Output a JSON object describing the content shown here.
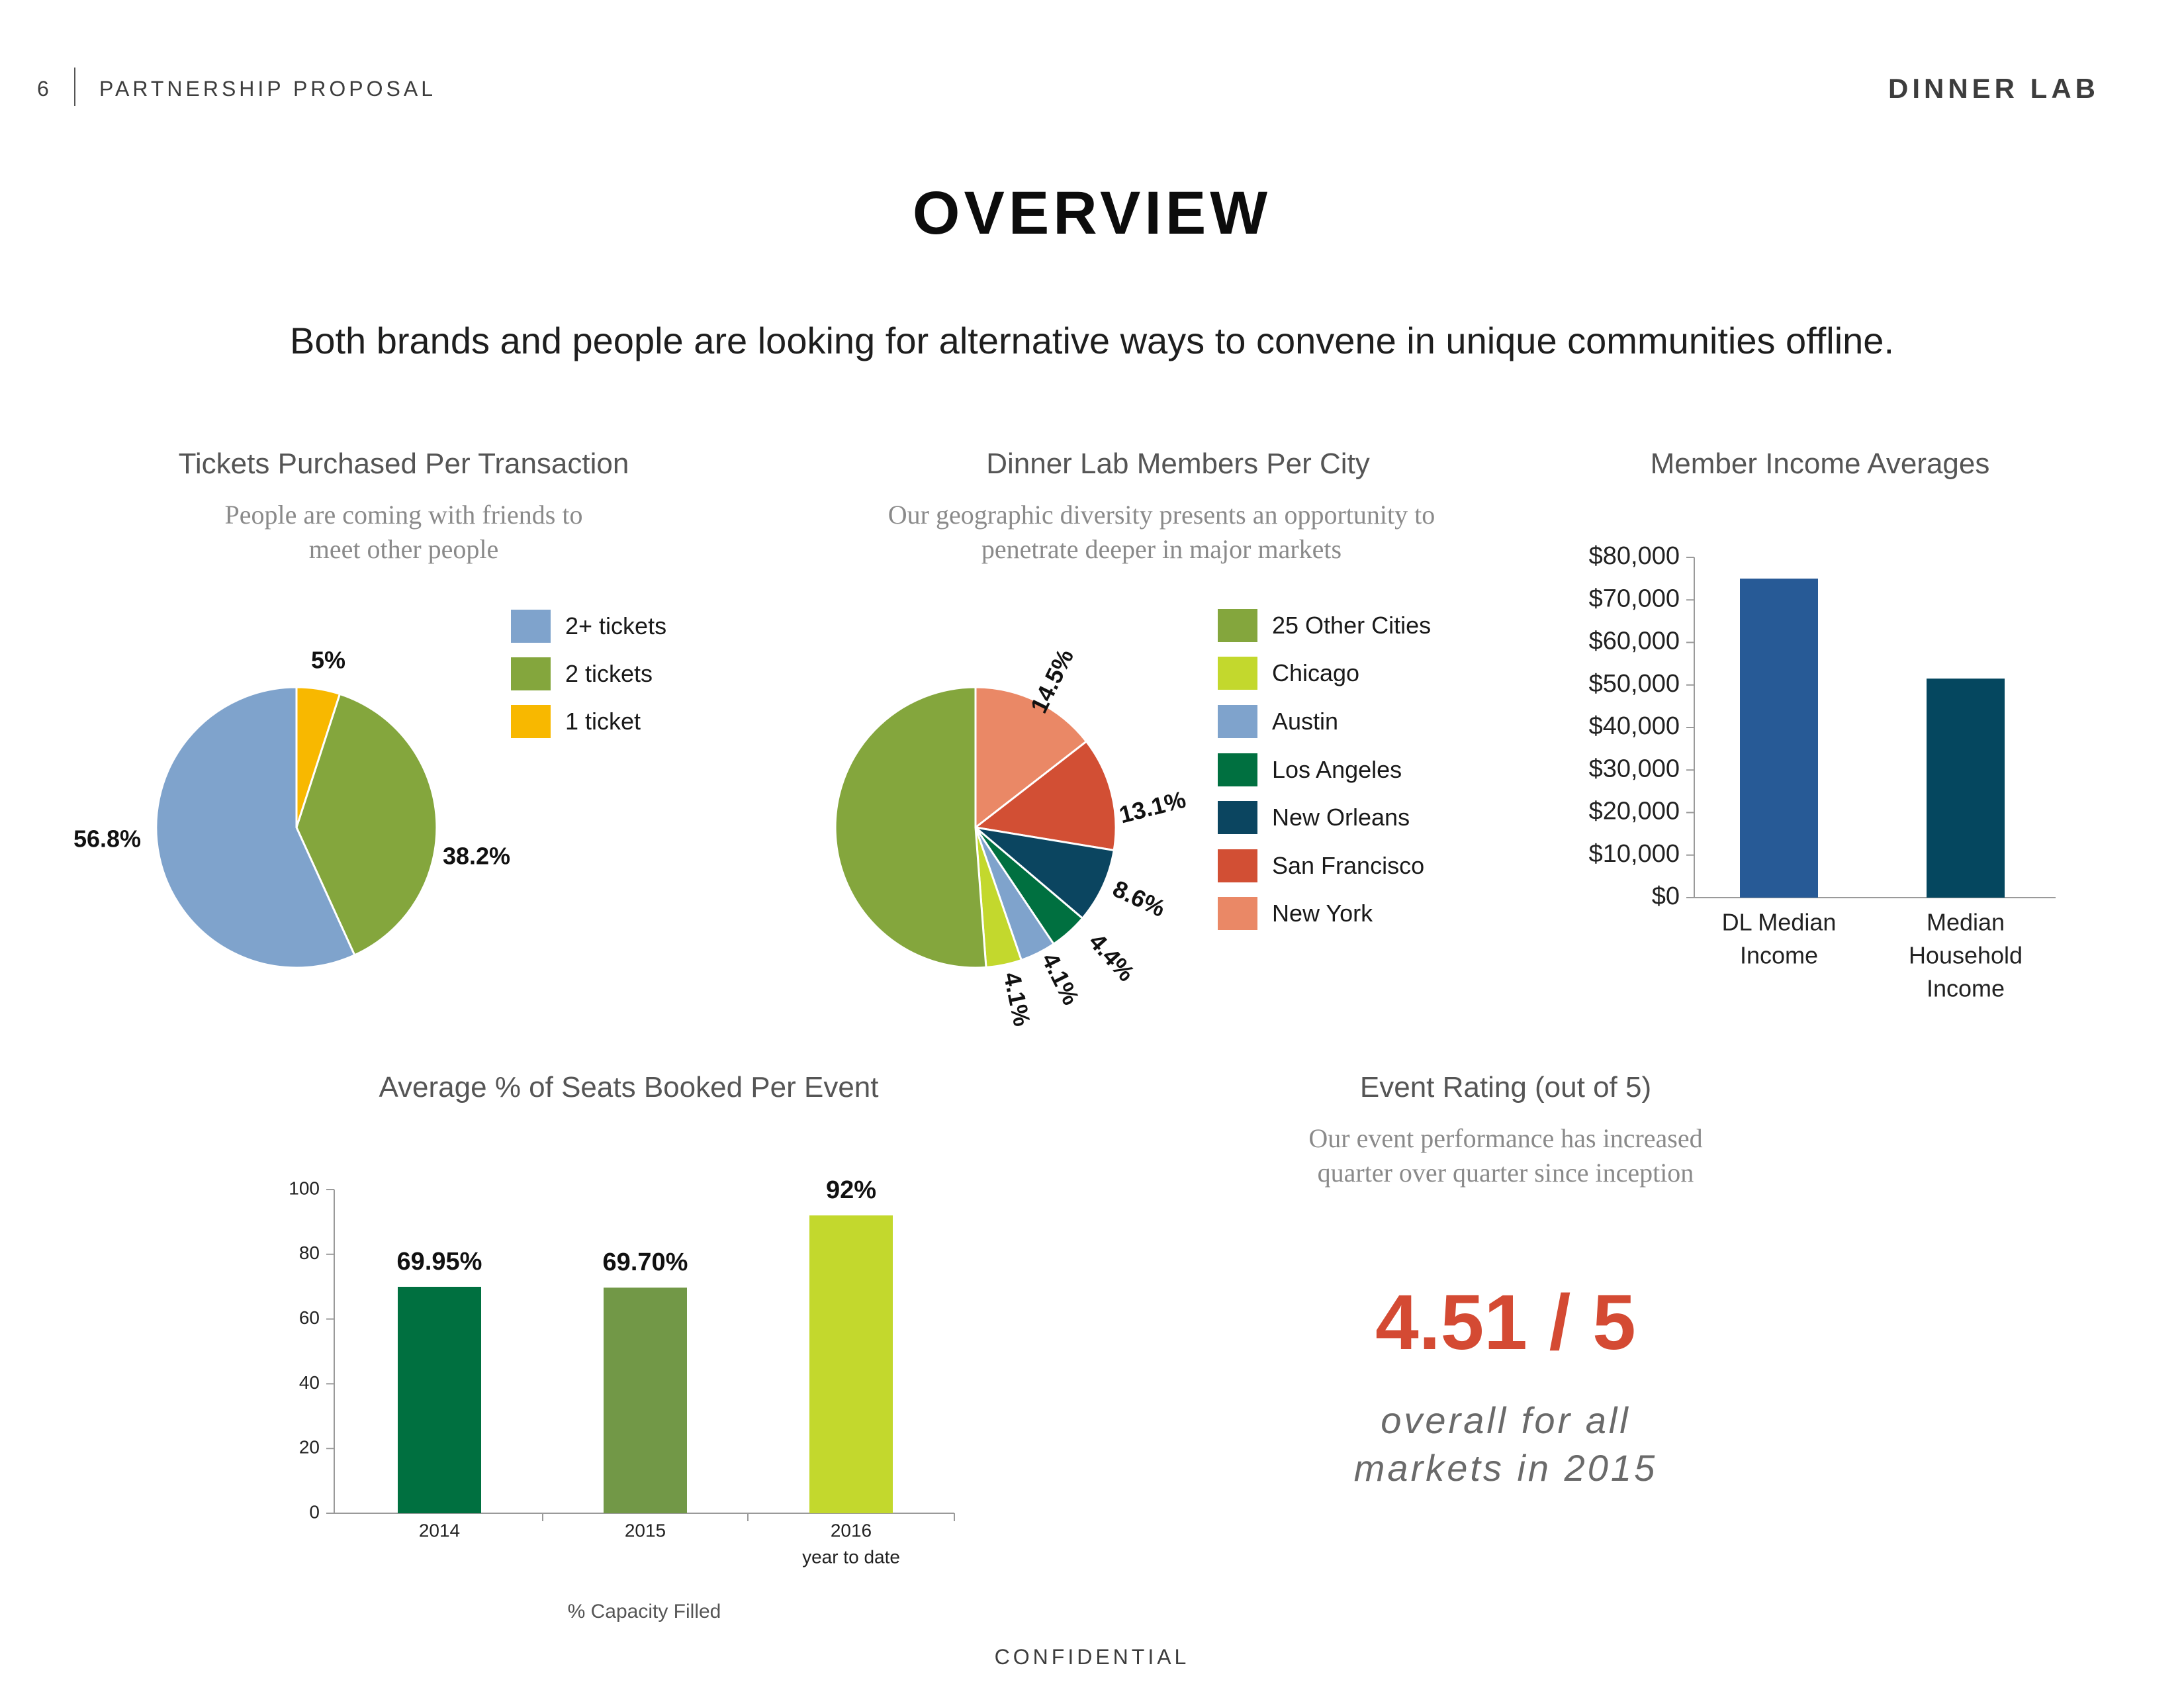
{
  "header": {
    "page_number": "6",
    "document_title": "PARTNERSHIP PROPOSAL",
    "brand": "DINNER LAB"
  },
  "page_title": "OVERVIEW",
  "tagline": "Both brands and people are looking for alternative ways to convene in unique communities offline.",
  "colors": {
    "blue_light": "#7fa3cc",
    "green": "#84a63d",
    "yellow": "#f8b800",
    "lime": "#c3d82d",
    "dark_green": "#007040",
    "navy": "#0b4560",
    "red": "#d24f34",
    "salmon": "#ea8866",
    "bar_blue": "#275a96",
    "bar_teal": "#05475f",
    "seat_2015": "#729847",
    "rating_red": "#d44a33"
  },
  "chart_data": [
    {
      "type": "pie",
      "title": "Tickets Purchased Per Transaction",
      "subtitle": "People are coming with friends to meet other people",
      "subtitle_lines": [
        "People are coming with friends to",
        "meet other people"
      ],
      "slices": [
        {
          "label": "1 ticket",
          "value": 5,
          "display": "5%",
          "color": "#f8b800"
        },
        {
          "label": "2 tickets",
          "value": 38.2,
          "display": "38.2%",
          "color": "#84a63d"
        },
        {
          "label": "2+ tickets",
          "value": 56.8,
          "display": "56.8%",
          "color": "#7fa3cc"
        }
      ],
      "legend": [
        {
          "label": "2+ tickets",
          "color": "#7fa3cc"
        },
        {
          "label": "2 tickets",
          "color": "#84a63d"
        },
        {
          "label": "1 ticket",
          "color": "#f8b800"
        }
      ],
      "legend_position": "right"
    },
    {
      "type": "pie",
      "title": "Dinner Lab Members Per City",
      "subtitle": "Our geographic diversity presents an opportunity to penetrate deeper in major markets",
      "subtitle_lines": [
        "Our geographic diversity presents an opportunity to",
        "penetrate deeper in major markets"
      ],
      "slices": [
        {
          "label": "New York",
          "value": 14.5,
          "display": "14.5%",
          "color": "#ea8866"
        },
        {
          "label": "San Francisco",
          "value": 13.1,
          "display": "13.1%",
          "color": "#d24f34"
        },
        {
          "label": "New Orleans",
          "value": 8.6,
          "display": "8.6%",
          "color": "#0b4560"
        },
        {
          "label": "Los Angeles",
          "value": 4.4,
          "display": "4.4%",
          "color": "#007040"
        },
        {
          "label": "Austin",
          "value": 4.1,
          "display": "4.1%",
          "color": "#7fa3cc"
        },
        {
          "label": "Chicago",
          "value": 4.1,
          "display": "4.1%",
          "color": "#c3d82d"
        },
        {
          "label": "25 Other Cities",
          "value": 51.2,
          "display": "",
          "color": "#84a63d"
        }
      ],
      "legend": [
        {
          "label": "25 Other Cities",
          "color": "#84a63d"
        },
        {
          "label": "Chicago",
          "color": "#c3d82d"
        },
        {
          "label": "Austin",
          "color": "#7fa3cc"
        },
        {
          "label": "Los Angeles",
          "color": "#007040"
        },
        {
          "label": "New Orleans",
          "color": "#0b4560"
        },
        {
          "label": "San Francisco",
          "color": "#d24f34"
        },
        {
          "label": "New York",
          "color": "#ea8866"
        }
      ],
      "legend_position": "right"
    },
    {
      "type": "bar",
      "title": "Member Income Averages",
      "categories": [
        "DL Median Income",
        "Median Household Income"
      ],
      "category_lines": [
        [
          "DL Median",
          "Income"
        ],
        [
          "Median",
          "Household",
          "Income"
        ]
      ],
      "values": [
        75000,
        51500
      ],
      "colors": [
        "#275a96",
        "#05475f"
      ],
      "ylim": [
        0,
        80000
      ],
      "yticks": [
        0,
        10000,
        20000,
        30000,
        40000,
        50000,
        60000,
        70000,
        80000
      ],
      "ytick_labels": [
        "$0",
        "$10,000",
        "$20,000",
        "$30,000",
        "$40,000",
        "$50,000",
        "$60,000",
        "$70,000",
        "$80,000"
      ],
      "grid": false
    },
    {
      "type": "bar",
      "title": "Average % of Seats Booked Per Event",
      "categories": [
        "2014",
        "2015",
        "2016 year to date"
      ],
      "category_lines": [
        [
          "2014"
        ],
        [
          "2015"
        ],
        [
          "2016",
          "year to date"
        ]
      ],
      "values": [
        69.95,
        69.7,
        92
      ],
      "data_labels": [
        "69.95%",
        "69.70%",
        "92%"
      ],
      "colors": [
        "#007040",
        "#729847",
        "#c3d82d"
      ],
      "ylim": [
        0,
        100
      ],
      "yticks": [
        0,
        20,
        40,
        60,
        80,
        100
      ],
      "ytick_labels": [
        "0",
        "20",
        "40",
        "60",
        "80",
        "100"
      ],
      "xlabel": "% Capacity Filled",
      "grid": false
    }
  ],
  "rating": {
    "title": "Event Rating (out of 5)",
    "subtitle_lines": [
      "Our event performance has increased",
      "quarter over quarter since inception"
    ],
    "value": "4.51 / 5",
    "caption_lines": [
      "overall for all",
      "markets in 2015"
    ]
  },
  "footer": "CONFIDENTIAL"
}
